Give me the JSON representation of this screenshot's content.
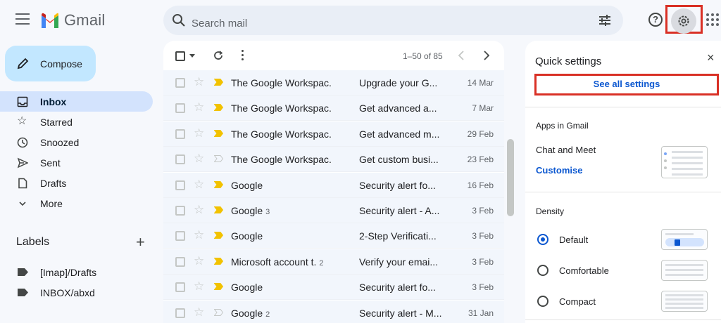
{
  "app": {
    "name": "Gmail"
  },
  "search": {
    "placeholder": "Search mail"
  },
  "compose": {
    "label": "Compose"
  },
  "nav": [
    {
      "label": "Inbox",
      "icon": "inbox-icon",
      "active": true
    },
    {
      "label": "Starred",
      "icon": "star-icon"
    },
    {
      "label": "Snoozed",
      "icon": "clock-icon"
    },
    {
      "label": "Sent",
      "icon": "send-icon"
    },
    {
      "label": "Drafts",
      "icon": "draft-icon"
    },
    {
      "label": "More",
      "icon": "chevron-down-icon"
    }
  ],
  "labels": {
    "title": "Labels",
    "add": "+",
    "items": [
      {
        "label": "[Imap]/Drafts"
      },
      {
        "label": "INBOX/abxd"
      }
    ]
  },
  "toolbar": {
    "count": "1–50 of 85"
  },
  "emails": [
    {
      "from": "The Google Workspac.",
      "count": "",
      "subject": "Upgrade your G...",
      "date": "14 Mar",
      "important": true
    },
    {
      "from": "The Google Workspac.",
      "count": "",
      "subject": "Get advanced a...",
      "date": "7 Mar",
      "important": true
    },
    {
      "from": "The Google Workspac.",
      "count": "",
      "subject": "Get advanced m...",
      "date": "29 Feb",
      "important": true
    },
    {
      "from": "The Google Workspac.",
      "count": "",
      "subject": "Get custom busi...",
      "date": "23 Feb",
      "important": false
    },
    {
      "from": "Google",
      "count": "",
      "subject": "Security alert fo...",
      "date": "16 Feb",
      "important": true
    },
    {
      "from": "Google",
      "count": "3",
      "subject": "Security alert - A...",
      "date": "3 Feb",
      "important": true
    },
    {
      "from": "Google",
      "count": "",
      "subject": "2-Step Verificati...",
      "date": "3 Feb",
      "important": true
    },
    {
      "from": "Microsoft account t.",
      "count": "2",
      "subject": "Verify your emai...",
      "date": "3 Feb",
      "important": true
    },
    {
      "from": "Google",
      "count": "",
      "subject": "Security alert fo...",
      "date": "3 Feb",
      "important": true
    },
    {
      "from": "Google",
      "count": "2",
      "subject": "Security alert - M...",
      "date": "31 Jan",
      "important": false
    }
  ],
  "quick_settings": {
    "title": "Quick settings",
    "close": "×",
    "see_all": "See all settings",
    "apps_section": "Apps in Gmail",
    "chat_meet": "Chat and Meet",
    "customise": "Customise",
    "density_section": "Density",
    "density_options": [
      {
        "label": "Default",
        "selected": true
      },
      {
        "label": "Comfortable",
        "selected": false
      },
      {
        "label": "Compact",
        "selected": false
      }
    ]
  },
  "colors": {
    "accent": "#0b57d0",
    "highlight": "#d93025",
    "important": "#f2c200"
  }
}
